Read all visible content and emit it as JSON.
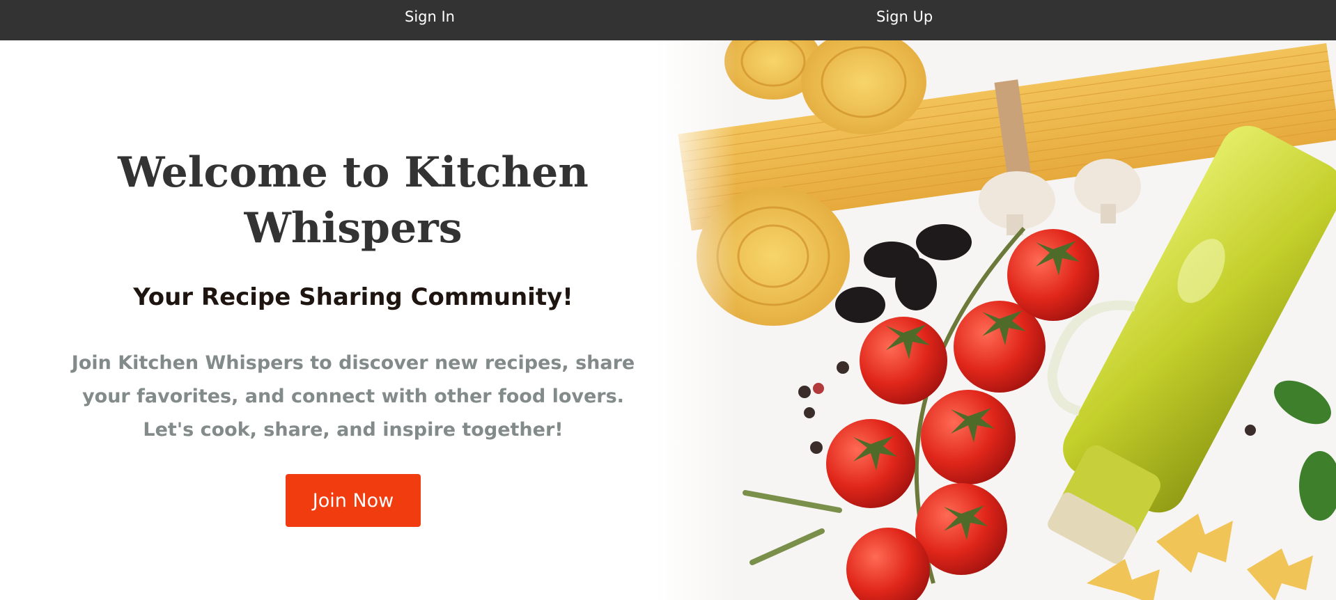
{
  "nav": {
    "sign_in_label": "Sign In",
    "sign_up_label": "Sign Up"
  },
  "hero": {
    "title": "Welcome to Kitchen Whispers",
    "subtitle": "Your Recipe Sharing Community!",
    "description": "Join Kitchen Whispers to discover new recipes, share your favorites, and connect with other food lovers. Let's cook, share, and inspire together!",
    "cta_label": "Join Now",
    "image_subject": "pasta, cherry tomatoes, olive oil bottle, mushrooms, olives"
  },
  "colors": {
    "navbar_bg": "#333333",
    "nav_text": "#ffffff",
    "title": "#333333",
    "subtitle": "#1e1410",
    "description": "#828a8a",
    "cta_bg": "#f03c0f",
    "cta_text": "#ffffff"
  }
}
